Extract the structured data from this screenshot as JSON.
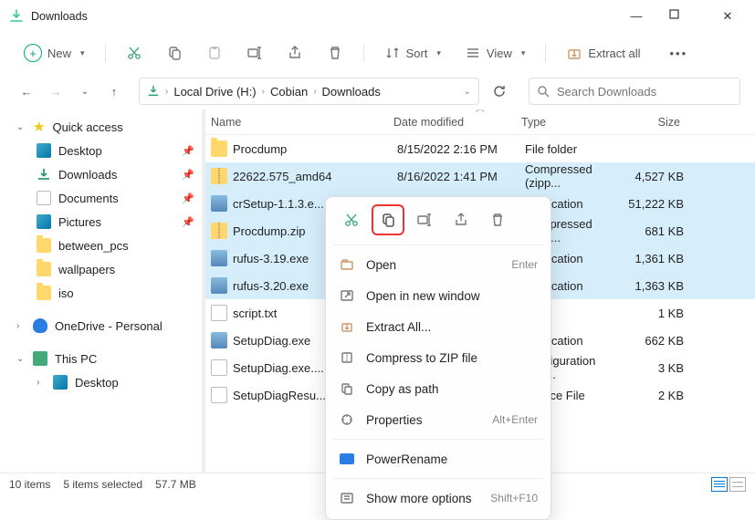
{
  "window": {
    "title": "Downloads"
  },
  "toolbar": {
    "new": "New",
    "sort": "Sort",
    "view": "View",
    "extract": "Extract all"
  },
  "breadcrumb": {
    "root": "Local Drive (H:)",
    "seg1": "Cobian",
    "seg2": "Downloads"
  },
  "search": {
    "placeholder": "Search Downloads"
  },
  "sidebar": {
    "quick": "Quick access",
    "desktop": "Desktop",
    "downloads": "Downloads",
    "documents": "Documents",
    "pictures": "Pictures",
    "between": "between_pcs",
    "wallpapers": "wallpapers",
    "iso": "iso",
    "onedrive": "OneDrive - Personal",
    "thispc": "This PC",
    "tpdesktop": "Desktop"
  },
  "columns": {
    "name": "Name",
    "date": "Date modified",
    "type": "Type",
    "size": "Size"
  },
  "rows": [
    {
      "name": "Procdump",
      "icon": "folder",
      "date": "8/15/2022 2:16 PM",
      "type": "File folder",
      "size": "",
      "sel": false
    },
    {
      "name": "22622.575_amd64",
      "icon": "zip",
      "date": "8/16/2022 1:41 PM",
      "type": "Compressed (zipp...",
      "size": "4,527 KB",
      "sel": true
    },
    {
      "name": "crSetup-1.1.3.e...",
      "icon": "app",
      "date": "",
      "type": "Application",
      "size": "51,222 KB",
      "sel": true
    },
    {
      "name": "Procdump.zip",
      "icon": "zip",
      "date": "",
      "type": "Compressed (zipp...",
      "size": "681 KB",
      "sel": true
    },
    {
      "name": "rufus-3.19.exe",
      "icon": "app",
      "date": "",
      "type": "Application",
      "size": "1,361 KB",
      "sel": true
    },
    {
      "name": "rufus-3.20.exe",
      "icon": "app",
      "date": "",
      "type": "Application",
      "size": "1,363 KB",
      "sel": true
    },
    {
      "name": "script.txt",
      "icon": "file",
      "date": "",
      "type": "",
      "size": "1 KB",
      "sel": false
    },
    {
      "name": "SetupDiag.exe",
      "icon": "app",
      "date": "",
      "type": "Application",
      "size": "662 KB",
      "sel": false
    },
    {
      "name": "SetupDiag.exe....",
      "icon": "file",
      "date": "",
      "type": "Configuration Sou...",
      "size": "3 KB",
      "sel": false
    },
    {
      "name": "SetupDiagResu...",
      "icon": "file",
      "date": "",
      "type": "Source File",
      "size": "2 KB",
      "sel": false
    }
  ],
  "context": {
    "open": "Open",
    "open_hint": "Enter",
    "openwin": "Open in new window",
    "extract": "Extract All...",
    "compress": "Compress to ZIP file",
    "copypath": "Copy as path",
    "properties": "Properties",
    "properties_hint": "Alt+Enter",
    "powerrename": "PowerRename",
    "more": "Show more options",
    "more_hint": "Shift+F10"
  },
  "status": {
    "items": "10 items",
    "selected": "5 items selected",
    "size": "57.7 MB"
  }
}
